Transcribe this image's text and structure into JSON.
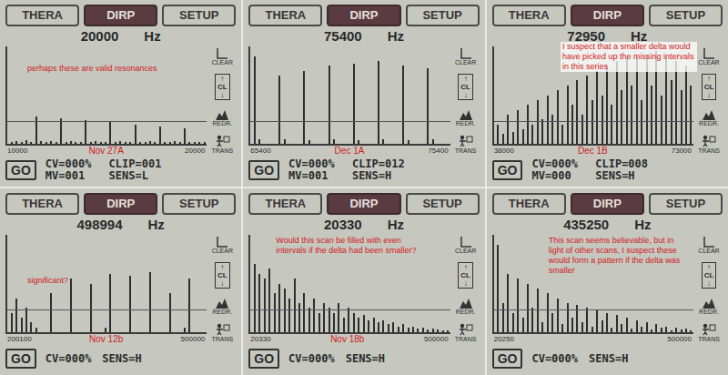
{
  "common": {
    "tabs": [
      {
        "label": "THERA",
        "selected": false
      },
      {
        "label": "DIRP",
        "selected": true
      },
      {
        "label": "SETUP",
        "selected": false
      }
    ],
    "unit": "Hz",
    "go": "GO",
    "sidebar": {
      "clear": "CLEAR",
      "up": "↑",
      "cl": "CL",
      "down": "↓",
      "redraw": "REDR.",
      "trans": "TRANS"
    }
  },
  "panels": [
    {
      "frequency": "20000",
      "axis": {
        "min": "10000",
        "max": "20000"
      },
      "label": "Nov 27A",
      "annotation": "perhaps these are valid resonances",
      "status": [
        "CV=000%",
        "CLIP=001",
        "MV=001",
        "SENS=L"
      ],
      "series": [
        2,
        3,
        2,
        4,
        2,
        28,
        3,
        2,
        3,
        2,
        26,
        2,
        3,
        2,
        2,
        24,
        2,
        3,
        2,
        2,
        22,
        2,
        3,
        2,
        2,
        20,
        2,
        2,
        3,
        2,
        18,
        2,
        2,
        3,
        2,
        16,
        2,
        2,
        2,
        2
      ]
    },
    {
      "frequency": "75400",
      "axis": {
        "min": "65400",
        "max": "75400"
      },
      "label": "Dec 1A",
      "status": [
        "CV=000%",
        "CLIP=012",
        "MV=001",
        "SENS=H"
      ],
      "series": [
        90,
        5,
        0,
        0,
        0,
        70,
        5,
        0,
        0,
        0,
        75,
        4,
        0,
        0,
        0,
        80,
        5,
        0,
        0,
        0,
        82,
        4,
        0,
        0,
        0,
        85,
        5,
        0,
        0,
        0,
        80,
        4,
        0,
        0,
        0,
        78,
        5,
        0,
        0,
        0
      ]
    },
    {
      "frequency": "72950",
      "axis": {
        "min": "38000",
        "max": "73000"
      },
      "label": "Dec 1B",
      "annotation": "I suspect that a smaller delta would have picked up the missing intervals in this series",
      "status": [
        "CV=000%",
        "CLIP=008",
        "MV=000",
        "SENS=H"
      ],
      "series": [
        20,
        10,
        30,
        12,
        35,
        15,
        40,
        20,
        45,
        25,
        50,
        30,
        55,
        20,
        60,
        40,
        65,
        30,
        70,
        45,
        75,
        50,
        80,
        40,
        85,
        55,
        88,
        60,
        90,
        45,
        92,
        60,
        95,
        50,
        90,
        65,
        85,
        55,
        80,
        60
      ]
    },
    {
      "frequency": "498994",
      "axis": {
        "min": "200100",
        "max": "500000"
      },
      "label": "Nov 12b",
      "annotation": "significant?",
      "status": [
        "CV=000%",
        "SENS=H"
      ],
      "series": [
        20,
        35,
        15,
        25,
        10,
        5,
        0,
        0,
        40,
        0,
        0,
        0,
        55,
        0,
        0,
        0,
        50,
        0,
        0,
        5,
        60,
        0,
        0,
        0,
        58,
        0,
        0,
        0,
        62,
        0,
        0,
        0,
        40,
        0,
        0,
        5,
        55,
        0,
        0,
        0
      ]
    },
    {
      "frequency": "20330",
      "axis": {
        "min": "20330",
        "max": "500000"
      },
      "label": "Nov 18b",
      "annotation": "Would this scan be filled with even intervals if the delta had been smaller?",
      "status": [
        "CV=000%",
        "SENS=H"
      ],
      "series": [
        70,
        60,
        55,
        65,
        40,
        50,
        45,
        35,
        55,
        30,
        40,
        25,
        35,
        20,
        30,
        25,
        20,
        30,
        15,
        25,
        20,
        15,
        18,
        12,
        15,
        10,
        12,
        8,
        10,
        6,
        8,
        5,
        6,
        4,
        5,
        3,
        4,
        3,
        2,
        2
      ]
    },
    {
      "frequency": "435250",
      "axis": {
        "min": "20250",
        "max": "500000"
      },
      "annotation": "This scan seems believable, but in light of other scans, I suspect these would form a pattern if the delta was smaller",
      "status": [
        "CV=000%",
        "SENS=H"
      ],
      "series": [
        90,
        30,
        60,
        20,
        55,
        15,
        50,
        25,
        45,
        10,
        40,
        20,
        35,
        8,
        30,
        15,
        28,
        10,
        25,
        6,
        22,
        12,
        20,
        5,
        18,
        8,
        15,
        4,
        12,
        6,
        10,
        3,
        8,
        5,
        6,
        2,
        5,
        3,
        4,
        2
      ]
    }
  ]
}
